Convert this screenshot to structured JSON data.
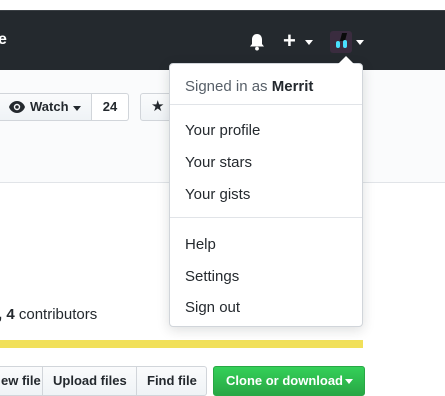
{
  "header": {
    "brand_fragment": "e",
    "bell_icon": "bell-icon",
    "plus_icon": "plus-icon",
    "avatar_icon": "avatar-icon"
  },
  "repo_actions": {
    "watch_label": "Watch",
    "watch_count": "24",
    "star_icon": "star-icon"
  },
  "summary": {
    "contributors_count": "4",
    "contributors_label": "contributors",
    "leading_fragment": ","
  },
  "file_actions": {
    "new_file": "ew file",
    "upload_files": "Upload files",
    "find_file": "Find file",
    "clone_download": "Clone or download"
  },
  "user_menu": {
    "signed_in_prefix": "Signed in as",
    "username": "Merrit",
    "items_group1": [
      "Your profile",
      "Your stars",
      "Your gists"
    ],
    "items_group2": [
      "Help",
      "Settings",
      "Sign out"
    ]
  },
  "colors": {
    "header_bg": "#24292e",
    "clone_green": "#28a745",
    "language_bar": "#f1e05a"
  }
}
